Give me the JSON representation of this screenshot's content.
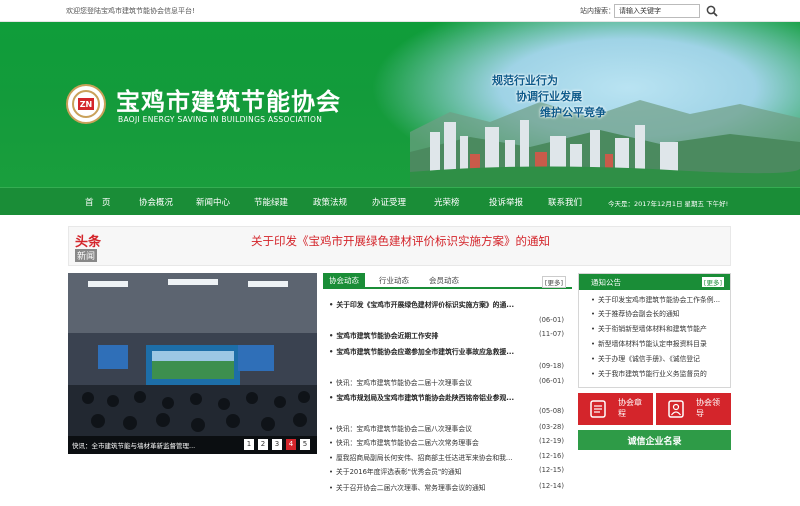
{
  "topbar": {
    "welcome": "欢迎您登陆宝鸡市建筑节能协会信息平台!",
    "search_label": "站内搜索：",
    "search_value": "请输入关键字"
  },
  "banner": {
    "logo_text": "ZN",
    "title_cn": "宝鸡市建筑节能协会",
    "title_en": "BAOJI ENERGY SAVING IN BUILDINGS ASSOCIATION",
    "slogans": [
      "规范行业行为",
      "协调行业发展",
      "维护公平竞争"
    ]
  },
  "nav": {
    "items": [
      "首　页",
      "协会概况",
      "新闻中心",
      "节能绿建",
      "政策法规",
      "办证受理",
      "光荣榜",
      "投诉举报",
      "联系我们"
    ],
    "date_text": "今天是：2017年12月1日 星期五 下午好!"
  },
  "headline": {
    "badge_top": "头条",
    "badge_bottom": "新闻",
    "text": "关于印发《宝鸡市开展绿色建材评价标识实施方案》的通知"
  },
  "slideshow": {
    "caption": "快讯：全市建筑节能与墙材革新监督管理...",
    "pages": [
      "1",
      "2",
      "3",
      "4",
      "5"
    ],
    "active_page": "4"
  },
  "news": {
    "tabs": [
      "协会动态",
      "行业动态",
      "会员动态"
    ],
    "active_tab": "协会动态",
    "more": "[更多]",
    "items": [
      {
        "title": "关于印发《宝鸡市开展绿色建材评价标识实施方案》的通...",
        "date": "(06-01)",
        "bold": true
      },
      {
        "title": "宝鸡市建筑节能协会近期工作安排",
        "date": "(11-07)",
        "bold": true
      },
      {
        "title": "宝鸡市建筑节能协会应邀参加全市建筑行业事故应急救援...",
        "date": "(09-18)",
        "bold": true
      },
      {
        "title": "快讯：宝鸡市建筑节能协会二届十次理事会议",
        "date": "(06-01)",
        "bold": false
      },
      {
        "title": "宝鸡市规划局及宝鸡市建筑节能协会赴陕西铭帝铝业参观...",
        "date": "(05-08)",
        "bold": true
      },
      {
        "title": "快讯：宝鸡市建筑节能协会二届八次理事会议",
        "date": "(03-28)",
        "bold": false
      },
      {
        "title": "快讯：宝鸡市建筑节能协会二届六次常务理事会",
        "date": "(12-19)",
        "bold": false
      },
      {
        "title": "厘我招商局副局长何安伟、招商部主任达进军来协会和我...",
        "date": "(12-16)",
        "bold": false
      },
      {
        "title": "关于2016年度评选表彰\"优秀会员\"的通知",
        "date": "(12-15)",
        "bold": false
      },
      {
        "title": "关于召开协会二届六次理事、常务理事会议的通知",
        "date": "(12-14)",
        "bold": false
      }
    ]
  },
  "notice": {
    "title": "通知公告",
    "more": "[更多]",
    "items": [
      "关于印发宝鸡市建筑节能协会工作条例...",
      "关于推荐协会副会长的通知",
      "关于衔销新型墙体材料和建筑节能产",
      "新型墙体材料节能认定申报资料目录",
      "关于办理《诚信手册》、《诚信登记",
      "关于我市建筑节能行业义务监督员的"
    ]
  },
  "tiles": [
    {
      "label": "协会章程"
    },
    {
      "label": "协会领导"
    }
  ],
  "integrity": {
    "label": "诚信企业名录"
  },
  "colors": {
    "brand_green": "#1a8d37",
    "accent_red": "#d4252b"
  }
}
